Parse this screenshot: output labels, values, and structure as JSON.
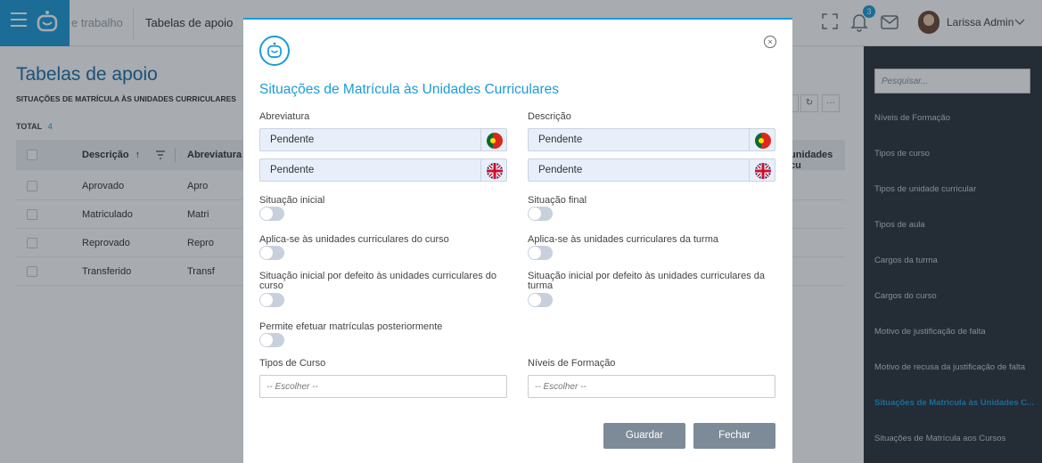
{
  "topbar": {
    "crumb_partial": "e trabalho",
    "crumb_current": "Tabelas de apoio",
    "notifications_count": "3",
    "user_name": "Larissa Admin",
    "icons": [
      "menu-icon",
      "app-logo-icon",
      "fullscreen-icon",
      "bell-icon",
      "mail-icon",
      "chevron-down-icon"
    ]
  },
  "page": {
    "title": "Tabelas de apoio",
    "subtitle": "SITUAÇÕES DE MATRÍCULA ÀS UNIDADES CURRICULARES",
    "total_label": "TOTAL",
    "total_count": "4",
    "columns": [
      "Descrição",
      "Abreviatura",
      "unidades cu"
    ],
    "sort_indicator": "↑",
    "rows": [
      {
        "descricao": "Aprovado",
        "abreviatura": "Apro"
      },
      {
        "descricao": "Matriculado",
        "abreviatura": "Matri"
      },
      {
        "descricao": "Reprovado",
        "abreviatura": "Repro"
      },
      {
        "descricao": "Transferido",
        "abreviatura": "Transf"
      }
    ]
  },
  "sidebar": {
    "search_placeholder": "Pesquisar...",
    "items": [
      {
        "label": "Níveis de Formação"
      },
      {
        "label": "Tipos de curso"
      },
      {
        "label": "Tipos de unidade curricular"
      },
      {
        "label": "Tipos de aula"
      },
      {
        "label": "Cargos da turma"
      },
      {
        "label": "Cargos do curso"
      },
      {
        "label": "Motivo de justificação de falta"
      },
      {
        "label": "Motivo de recusa da justificação de falta"
      },
      {
        "label": "Situações de Matrícula às Unidades C..."
      },
      {
        "label": "Situações de Matrícula aos Cursos"
      }
    ],
    "active_index": 8
  },
  "modal": {
    "title": "Situações de Matrícula às Unidades Curriculares",
    "abreviatura_label": "Abreviatura",
    "descricao_label": "Descrição",
    "abreviatura_pt": "Pendente",
    "abreviatura_en": "Pendente",
    "descricao_pt": "Pendente",
    "descricao_en": "Pendente",
    "toggles": [
      {
        "label": "Situação inicial",
        "on": false
      },
      {
        "label": "Situação final",
        "on": false
      },
      {
        "label": "Aplica-se às unidades curriculares do curso",
        "on": false
      },
      {
        "label": "Aplica-se às unidades curriculares da turma",
        "on": false
      },
      {
        "label": "Situação inicial por defeito às unidades curriculares do curso",
        "on": false
      },
      {
        "label": "Situação inicial por defeito às unidades curriculares da turma",
        "on": false
      },
      {
        "label": "Permite efetuar matrículas posteriormente",
        "on": false
      }
    ],
    "tipos_curso_label": "Tipos de Curso",
    "niveis_formacao_label": "Níveis de Formação",
    "select_placeholder": "-- Escolher --",
    "save_label": "Guardar",
    "close_label": "Fechar"
  },
  "colors": {
    "accent": "#1c9bd8",
    "sidebar_bg": "#2b323a",
    "button_bg": "#7d8a97",
    "input_bg": "#e8effa"
  }
}
